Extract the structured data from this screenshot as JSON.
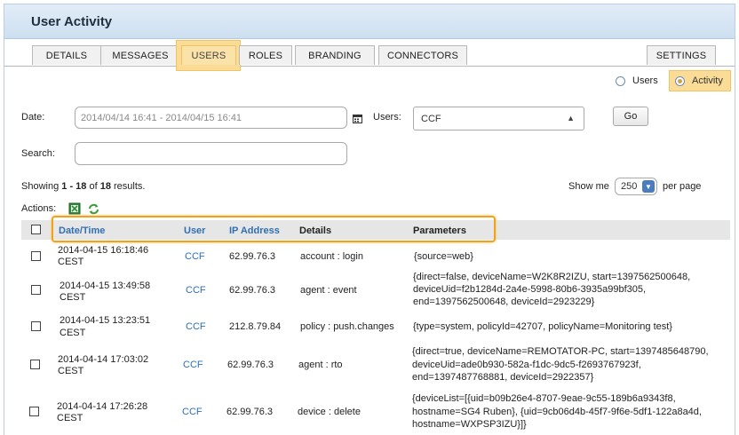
{
  "window": {
    "title": "User Activity"
  },
  "tabs": [
    {
      "label": "DETAILS",
      "active": false
    },
    {
      "label": "MESSAGES",
      "active": false
    },
    {
      "label": "USERS",
      "active": true
    },
    {
      "label": "ROLES",
      "active": false
    },
    {
      "label": "BRANDING",
      "active": false
    },
    {
      "label": "CONNECTORS",
      "active": false
    },
    {
      "label": "SETTINGS",
      "active": false
    }
  ],
  "view_toggle": {
    "users_label": "Users",
    "activity_label": "Activity",
    "selected": "Activity"
  },
  "filters": {
    "date_label": "Date:",
    "date_value": "2014/04/14 16:41 - 2014/04/15 16:41",
    "users_label": "Users:",
    "users_value": "CCF",
    "go_label": "Go",
    "search_label": "Search:",
    "search_value": ""
  },
  "results": {
    "showing_prefix": "Showing ",
    "range": "1 - 18",
    "of": " of ",
    "total": "18",
    "suffix": " results.",
    "show_me_label": "Show me",
    "page_size": "250",
    "per_page_label": "per page"
  },
  "actions": {
    "label": "Actions:",
    "icons": [
      "export-excel-icon",
      "refresh-icon"
    ]
  },
  "table": {
    "columns": [
      "Date/Time",
      "User",
      "IP Address",
      "Details",
      "Parameters"
    ],
    "rows": [
      {
        "date": "2014-04-15 16:18:46",
        "tz": "CEST",
        "user": "CCF",
        "ip": "62.99.76.3",
        "details": "account : login",
        "params": [
          "{source=web}"
        ]
      },
      {
        "date": "2014-04-15 13:49:58",
        "tz": "CEST",
        "user": "CCF",
        "ip": "62.99.76.3",
        "details": "agent : event",
        "params": [
          "{direct=false, deviceName=W2K8R2IZU, start=1397562500648,",
          "deviceUid=f2b1284d-2a4e-5998-80b6-3935a99bf305,",
          "end=1397562500648, deviceId=2923229}"
        ]
      },
      {
        "date": "2014-04-15 13:23:51",
        "tz": "CEST",
        "user": "CCF",
        "ip": "212.8.79.84",
        "details": "policy : push.changes",
        "params": [
          "{type=system, policyId=42707, policyName=Monitoring test}"
        ]
      },
      {
        "date": "2014-04-14 17:03:02",
        "tz": "CEST",
        "user": "CCF",
        "ip": "62.99.76.3",
        "details": "agent : rto",
        "params": [
          "{direct=true, deviceName=REMOTATOR-PC, start=1397485648790,",
          "deviceUid=ade0b930-582a-f1dc-9dc5-f2693767923f,",
          "end=1397487768881, deviceId=2922357}"
        ]
      },
      {
        "date": "2014-04-14 17:26:28",
        "tz": "CEST",
        "user": "CCF",
        "ip": "62.99.76.3",
        "details": "device : delete",
        "params": [
          "{deviceList=[{uid=b09b26e4-8707-9eae-9c55-189b6a9343f8,",
          "hostname=SG4 Ruben}, {uid=9cb06d4b-45f7-9f6e-5df1-122a8a4d,",
          "hostname=WXPSP3IZU}]}"
        ]
      }
    ]
  },
  "colors": {
    "accent": "#2f6fb5",
    "highlight": "#f0a21a",
    "title_bg": "#d4e4f4"
  }
}
